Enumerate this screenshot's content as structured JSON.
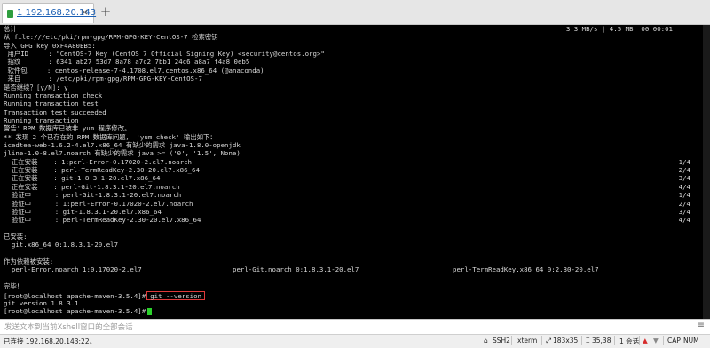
{
  "tab": {
    "number": "1",
    "label": "192.168.20.143",
    "close_glyph": "×"
  },
  "new_tab_glyph": "+",
  "terminal": {
    "lines": [
      {
        "text": "总计",
        "right": "3.3 MB/s | 4.5 MB  00:00:01"
      },
      {
        "text": "从 file:///etc/pki/rpm-gpg/RPM-GPG-KEY-CentOS-7 检索密钥"
      },
      {
        "text": "导入 GPG key 0xF4A80EB5:"
      },
      {
        "text": " 用户ID     : \"CentOS-7 Key (CentOS 7 Official Signing Key) <security@centos.org>\""
      },
      {
        "text": " 指纹       : 6341 ab27 53d7 8a78 a7c2 7bb1 24c6 a8a7 f4a8 0eb5"
      },
      {
        "text": " 软件包     : centos-release-7-4.1708.el7.centos.x86_64 (@anaconda)"
      },
      {
        "text": " 来自       : /etc/pki/rpm-gpg/RPM-GPG-KEY-CentOS-7"
      },
      {
        "text": "是否继续？[y/N]: y"
      },
      {
        "text": "Running transaction check"
      },
      {
        "text": "Running transaction test"
      },
      {
        "text": "Transaction test succeeded"
      },
      {
        "text": "Running transaction"
      },
      {
        "text": "警告：RPM 数据库已被非 yum 程序修改。"
      },
      {
        "text": "** 发现 2 个已存在的 RPM 数据库问题， 'yum check' 输出如下："
      },
      {
        "text": "icedtea-web-1.6.2-4.el7.x86_64 有缺少的需求 java-1.8.0-openjdk"
      },
      {
        "text": "jline-1.0-8.el7.noarch 有缺少的需求 java >= ('0', '1.5', None)"
      },
      {
        "text": "  正在安装    : 1:perl-Error-0.17020-2.el7.noarch",
        "right": "1/4"
      },
      {
        "text": "  正在安装    : perl-TermReadKey-2.30-20.el7.x86_64",
        "right": "2/4"
      },
      {
        "text": "  正在安装    : git-1.8.3.1-20.el7.x86_64",
        "right": "3/4"
      },
      {
        "text": "  正在安装    : perl-Git-1.8.3.1-20.el7.noarch",
        "right": "4/4"
      },
      {
        "text": "  验证中      : perl-Git-1.8.3.1-20.el7.noarch",
        "right": "1/4"
      },
      {
        "text": "  验证中      : 1:perl-Error-0.17020-2.el7.noarch",
        "right": "2/4"
      },
      {
        "text": "  验证中      : git-1.8.3.1-20.el7.x86_64",
        "right": "3/4"
      },
      {
        "text": "  验证中      : perl-TermReadKey-2.30-20.el7.x86_64",
        "right": "4/4"
      },
      {
        "text": ""
      },
      {
        "text": "已安装:"
      },
      {
        "text": "  git.x86_64 0:1.8.3.1-20.el7"
      },
      {
        "text": ""
      },
      {
        "text": "作为依赖被安装:"
      },
      {
        "text": "  perl-Error.noarch 1:0.17020-2.el7",
        "col2": "perl-Git.noarch 0:1.8.3.1-20.el7",
        "col3": "perl-TermReadKey.x86_64 0:2.30-20.el7"
      },
      {
        "text": ""
      },
      {
        "text": "完毕！"
      },
      {
        "prompt": "[root@localhost apache-maven-3.5.4]#",
        "command": "git --version"
      },
      {
        "text": "git version 1.8.3.1"
      },
      {
        "prompt": "[root@localhost apache-maven-3.5.4]#",
        "cursor": true
      }
    ]
  },
  "input_hint": {
    "text": "发送文本到当前Xshell窗口的全部会话",
    "menu_glyph": "≡"
  },
  "statusbar": {
    "connection": "已连接 192.168.20.143:22。",
    "protocol": "SSH2",
    "terminal_type": "xterm",
    "size": "183x35",
    "cursor_pos": "35,38",
    "sessions": "1 会话",
    "caps": "CAP",
    "num": "NUM"
  },
  "colors": {
    "terminal_bg": "#000000",
    "terminal_fg": "#d8d8d8",
    "highlight_border": "#e03a3a",
    "cursor": "#2bd12b"
  }
}
